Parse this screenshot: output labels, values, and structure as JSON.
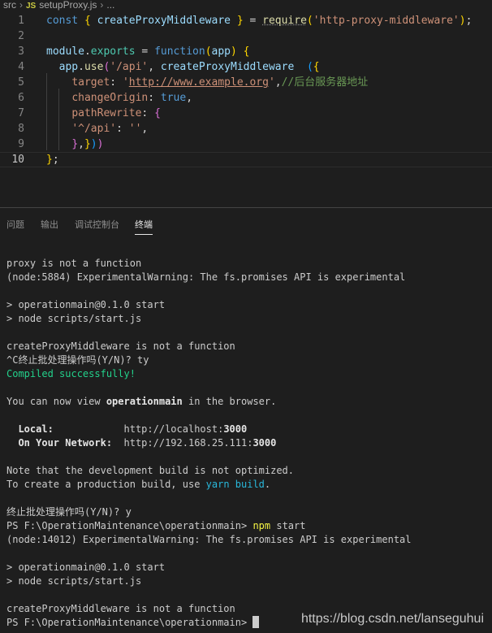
{
  "breadcrumb": {
    "folder": "src",
    "file_badge": "JS",
    "file": "setupProxy.js",
    "more": "..."
  },
  "editor": {
    "current_line": 10,
    "lines": [
      {
        "n": "1",
        "tokens": [
          [
            "kw",
            "const "
          ],
          [
            "b1",
            "{ "
          ],
          [
            "id",
            "createProxyMiddleware "
          ],
          [
            "b1",
            "}"
          ],
          [
            "plain",
            " = "
          ],
          [
            "fn req",
            "require"
          ],
          [
            "b1",
            "("
          ],
          [
            "str",
            "'http-proxy-middleware'"
          ],
          [
            "b1",
            ")"
          ],
          [
            "plain",
            ";"
          ]
        ]
      },
      {
        "n": "2",
        "tokens": []
      },
      {
        "n": "3",
        "tokens": [
          [
            "id",
            "module"
          ],
          [
            "plain",
            "."
          ],
          [
            "prop",
            "exports"
          ],
          [
            "plain",
            " = "
          ],
          [
            "kw",
            "function"
          ],
          [
            "b1",
            "("
          ],
          [
            "id",
            "app"
          ],
          [
            "b1",
            ")"
          ],
          [
            "plain",
            " "
          ],
          [
            "b1",
            "{"
          ]
        ]
      },
      {
        "n": "4",
        "tokens": [
          [
            "plain",
            "  "
          ],
          [
            "id",
            "app"
          ],
          [
            "plain",
            "."
          ],
          [
            "fn",
            "use"
          ],
          [
            "b2",
            "("
          ],
          [
            "str",
            "'/api'"
          ],
          [
            "plain",
            ", "
          ],
          [
            "id",
            "createProxyMiddleware"
          ],
          [
            "plain",
            "  "
          ],
          [
            "b3",
            "("
          ],
          [
            "b1",
            "{"
          ]
        ]
      },
      {
        "n": "5",
        "tokens": [
          [
            "plain",
            "    "
          ],
          [
            "str",
            "target"
          ],
          [
            "plain",
            ": "
          ],
          [
            "str",
            "'"
          ],
          [
            "str url",
            "http://www.example.org"
          ],
          [
            "str",
            "'"
          ],
          [
            "plain",
            ","
          ],
          [
            "cm",
            "//后台服务器地址"
          ]
        ]
      },
      {
        "n": "6",
        "tokens": [
          [
            "plain",
            "    "
          ],
          [
            "str",
            "changeOrigin"
          ],
          [
            "plain",
            ": "
          ],
          [
            "kw",
            "true"
          ],
          [
            "plain",
            ","
          ]
        ]
      },
      {
        "n": "7",
        "tokens": [
          [
            "plain",
            "    "
          ],
          [
            "str",
            "pathRewrite"
          ],
          [
            "plain",
            ": "
          ],
          [
            "b2",
            "{"
          ]
        ]
      },
      {
        "n": "8",
        "tokens": [
          [
            "plain",
            "    "
          ],
          [
            "str",
            "'^/api'"
          ],
          [
            "plain",
            ": "
          ],
          [
            "str",
            "''"
          ],
          [
            "plain",
            ","
          ]
        ]
      },
      {
        "n": "9",
        "tokens": [
          [
            "plain",
            "    "
          ],
          [
            "b2",
            "}"
          ],
          [
            "plain",
            ","
          ],
          [
            "b1",
            "}"
          ],
          [
            "b3",
            ")"
          ],
          [
            "b2",
            ")"
          ]
        ]
      },
      {
        "n": "10",
        "tokens": [
          [
            "b1",
            "}"
          ],
          [
            "plain",
            ";"
          ]
        ]
      }
    ]
  },
  "panel": {
    "tabs": [
      {
        "label": "问题",
        "active": false
      },
      {
        "label": "输出",
        "active": false
      },
      {
        "label": "调试控制台",
        "active": false
      },
      {
        "label": "终端",
        "active": true
      }
    ]
  },
  "terminal": {
    "lines": [
      [
        [
          "",
          "proxy is not a function"
        ]
      ],
      [
        [
          "",
          "(node:5884) ExperimentalWarning: The fs.promises API is experimental"
        ]
      ],
      [
        [
          "",
          ""
        ]
      ],
      [
        [
          "",
          "> operationmain@0.1.0 start"
        ]
      ],
      [
        [
          "",
          "> node scripts/start.js"
        ]
      ],
      [
        [
          "",
          ""
        ]
      ],
      [
        [
          "",
          "createProxyMiddleware is not a function"
        ]
      ],
      [
        [
          "",
          "^C终止批处理操作吗(Y/N)? ty"
        ]
      ],
      [
        [
          "green",
          "Compiled successfully!"
        ]
      ],
      [
        [
          "",
          ""
        ]
      ],
      [
        [
          "",
          "You can now view "
        ],
        [
          "bold",
          "operationmain"
        ],
        [
          "",
          " in the browser."
        ]
      ],
      [
        [
          "",
          ""
        ]
      ],
      [
        [
          "bold",
          "  Local:            "
        ],
        [
          "",
          "http://localhost:"
        ],
        [
          "bold",
          "3000"
        ]
      ],
      [
        [
          "bold",
          "  On Your Network:  "
        ],
        [
          "",
          "http://192.168.25.111:"
        ],
        [
          "bold",
          "3000"
        ]
      ],
      [
        [
          "",
          ""
        ]
      ],
      [
        [
          "",
          "Note that the development build is not optimized."
        ]
      ],
      [
        [
          "",
          "To create a production build, use "
        ],
        [
          "cyan",
          "yarn build"
        ],
        [
          "",
          "."
        ]
      ],
      [
        [
          "",
          ""
        ]
      ],
      [
        [
          "",
          "终止批处理操作吗(Y/N)? y"
        ]
      ],
      [
        [
          "",
          "PS F:\\OperationMaintenance\\operationmain> "
        ],
        [
          "yellow",
          "npm"
        ],
        [
          "",
          " start"
        ]
      ],
      [
        [
          "",
          "(node:14012) ExperimentalWarning: The fs.promises API is experimental"
        ]
      ],
      [
        [
          "",
          ""
        ]
      ],
      [
        [
          "",
          "> operationmain@0.1.0 start"
        ]
      ],
      [
        [
          "",
          "> node scripts/start.js"
        ]
      ],
      [
        [
          "",
          ""
        ]
      ],
      [
        [
          "",
          "createProxyMiddleware is not a function"
        ]
      ],
      [
        [
          "",
          "PS F:\\OperationMaintenance\\operationmain> "
        ],
        [
          "cursor",
          ""
        ]
      ]
    ]
  },
  "watermark": "https://blog.csdn.net/lanseguhui"
}
